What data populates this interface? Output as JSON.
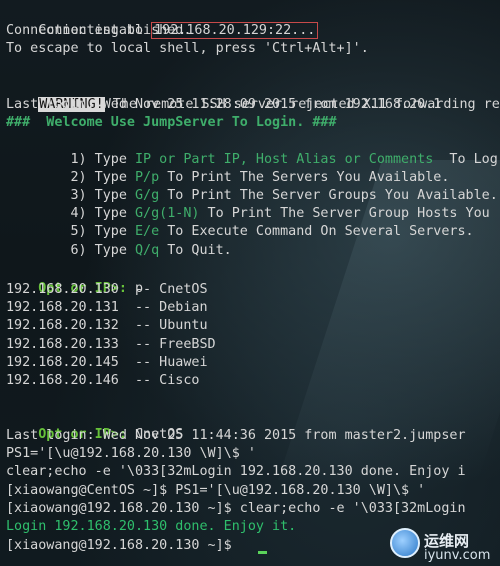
{
  "terminal": {
    "connect_prefix": "Connecting to ",
    "connect_host": "192.168.20.129:22...",
    "established": "Connection established.",
    "escape_hint": "To escape to local shell, press 'Ctrl+Alt+]'.",
    "warning_tag": "WARNING!",
    "warning_text": " The remote SSH server rejected X11 forwarding re",
    "last_login_1": "Last login: Wed Nov 25 11:28:09 2015 from 192.168.20.1",
    "welcome": "###  Welcome Use JumpServer To Login. ###",
    "menu": [
      {
        "n": "    1) Type ",
        "k": "IP or Part IP, Host Alias or Comments",
        "t": "  To Log"
      },
      {
        "n": "    2) Type ",
        "k": "P/p",
        "t": " To Print The Servers You Available."
      },
      {
        "n": "    3) Type ",
        "k": "G/g",
        "t": " To Print The Server Groups You Available."
      },
      {
        "n": "    4) Type ",
        "k": "G/g(1-N)",
        "t": " To Print The Server Group Hosts You"
      },
      {
        "n": "    5) Type ",
        "k": "E/e",
        "t": " To Execute Command On Several Servers."
      },
      {
        "n": "    6) Type ",
        "k": "Q/q",
        "t": " To Quit."
      }
    ],
    "prompt_1": "Opt or IP>:",
    "input_1": " p",
    "hosts": [
      "192.168.20.130  -- CnetOS",
      "192.168.20.131  -- Debian",
      "192.168.20.132  -- Ubuntu",
      "192.168.20.133  -- FreeBSD",
      "192.168.20.145  -- Huawei",
      "192.168.20.146  -- Cisco"
    ],
    "prompt_2": "Opt or IP>:",
    "input_2": " CnetOS",
    "last_login_2": "Last login: Wed Nov 25 11:44:36 2015 from master2.jumpser",
    "ps1_cmd": "PS1='[\\u@192.168.20.130 \\W]\\$ '",
    "echo_cmd": "clear;echo -e '\\033[32mLogin 192.168.20.130 done. Enjoy i",
    "shell_1": "[xiaowang@CentOS ~]$ PS1='[\\u@192.168.20.130 \\W]\\$ '",
    "shell_2": "[xiaowang@192.168.20.130 ~]$ clear;echo -e '\\033[32mLogin",
    "login_done": "Login 192.168.20.130 done. Enjoy it.",
    "shell_3": "[xiaowang@192.168.20.130 ~]$ "
  },
  "watermark": {
    "cn": "运维网",
    "url": "iyunv.com"
  },
  "colors": {
    "highlight_box": "#c74a4a",
    "prompt": "#67c23a",
    "menu_keys": "#3fae6b",
    "cursor": "#5bd35b"
  }
}
